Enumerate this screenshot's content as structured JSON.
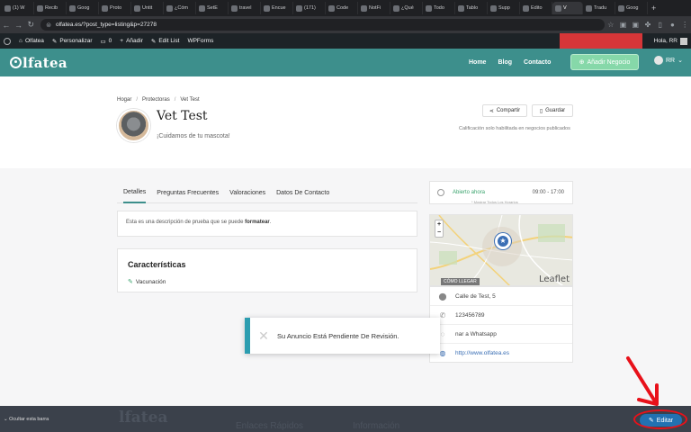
{
  "browser": {
    "tabs": [
      {
        "label": "(1) W"
      },
      {
        "label": "Recib"
      },
      {
        "label": "Goog"
      },
      {
        "label": "Proto"
      },
      {
        "label": "Untit"
      },
      {
        "label": "¿Cóm"
      },
      {
        "label": "SetE"
      },
      {
        "label": "travel"
      },
      {
        "label": "Encue"
      },
      {
        "label": "(171)"
      },
      {
        "label": "Code"
      },
      {
        "label": "NotFi"
      },
      {
        "label": "¿Qué"
      },
      {
        "label": "Todo"
      },
      {
        "label": "Tablo"
      },
      {
        "label": "Supp"
      },
      {
        "label": "Edito"
      },
      {
        "label": "V",
        "active": true
      },
      {
        "label": "Tradu"
      },
      {
        "label": "Goog"
      }
    ],
    "url": "olfatea.es/?post_type=listing&p=27278"
  },
  "wp_admin_bar": {
    "site": "Olfatea",
    "customize": "Personalizar",
    "comments": "0",
    "add_new": "Añadir",
    "edit_list": "Edit List",
    "wpforms": "WPForms",
    "user_greeting": "Hola, RR"
  },
  "site_header": {
    "logo": "lfatea",
    "nav": [
      "Home",
      "Blog",
      "Contacto"
    ],
    "add_button": "Añadir Negocio",
    "user": "RR"
  },
  "listing": {
    "breadcrumbs": [
      "Hogar",
      "Protectoras",
      "Vet Test"
    ],
    "title": "Vet Test",
    "tagline": "¡Cuidamos de tu mascota!",
    "share": "Compartir",
    "save": "Guardar",
    "rating_note": "Calificación solo habilitada en negocios publicados",
    "tabs": [
      "Detalles",
      "Preguntas Frecuentes",
      "Valoraciones",
      "Datos De Contacto"
    ],
    "description_prefix": "Esta es una descripción de prueba que se puede ",
    "description_bold": "formatear",
    "description_suffix": ".",
    "features_title": "Características",
    "features": [
      "Vacunación"
    ]
  },
  "sidebar": {
    "status": "Abierto ahora",
    "hours": "09:00 - 17:00",
    "timezone_note": "* Mostrar Todos Los Horarios",
    "map_directions": "CÓMO LLEGAR",
    "map_attribution": "Leaflet",
    "address": "Calle de Test, 5",
    "phone": "123456789",
    "whatsapp": "nar a Whatsapp",
    "website": "http://www.olfatea.es"
  },
  "toast": {
    "message": "Su Anuncio Está Pendiente De Revisión."
  },
  "footer": {
    "hide_bar": "Ocultar esta barra",
    "watermark": "lfatea",
    "col2": "Enlaces Rápidos",
    "col3": "Información",
    "edit_button": "Editar"
  },
  "colors": {
    "brand": "#3d8f8c",
    "accent_green": "#86d8a9",
    "toast_accent": "#2c9db0",
    "annotation": "#e8111a",
    "edit_button": "#2271b1"
  }
}
